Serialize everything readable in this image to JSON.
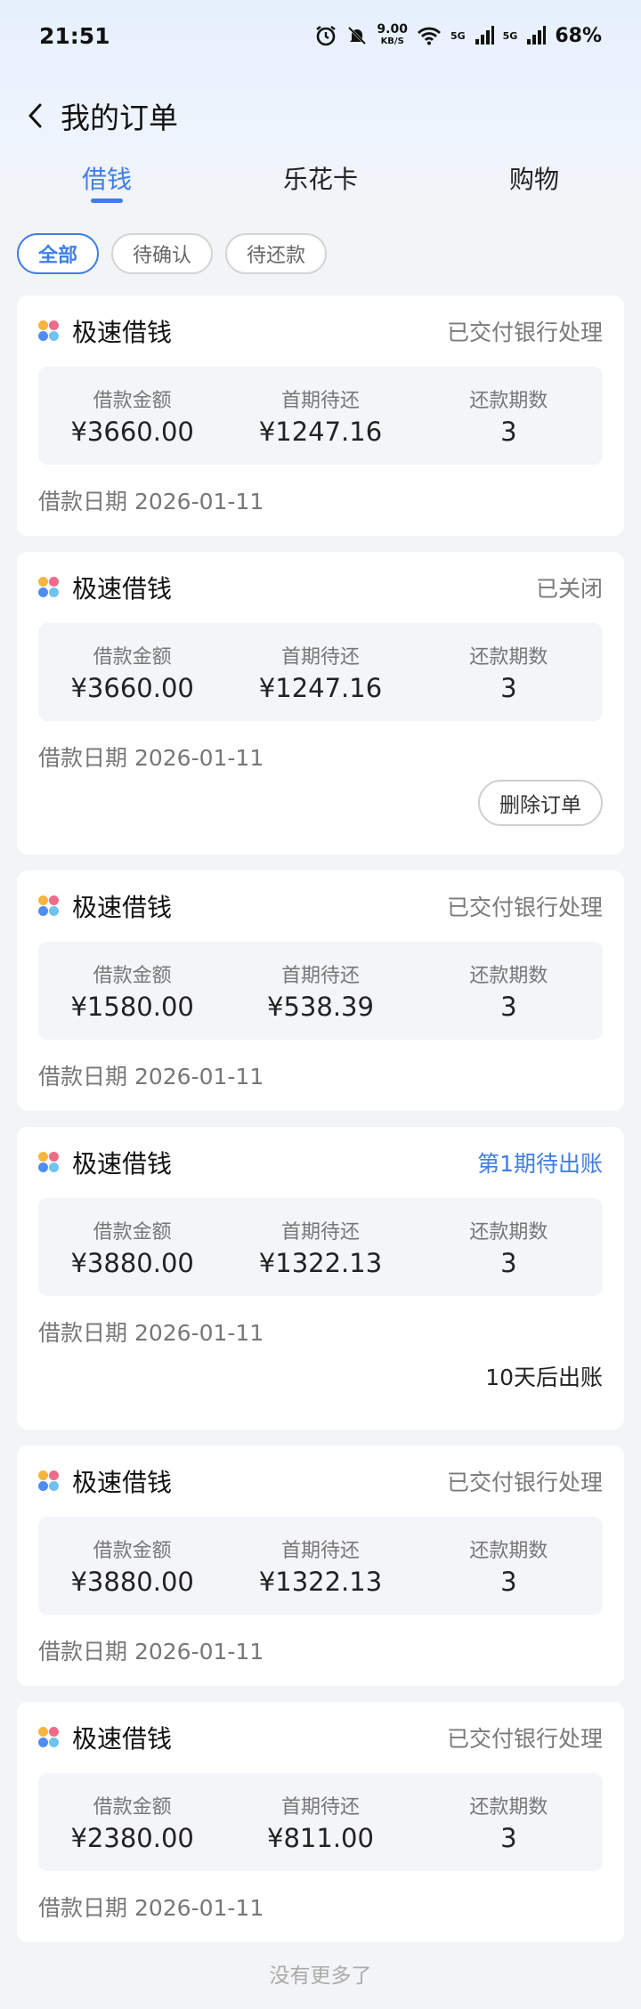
{
  "status_bar": {
    "time": "21:51",
    "net_speed": "9.00",
    "net_unit": "KB/S",
    "sig1": "5G",
    "sig2": "5G",
    "battery": "68%"
  },
  "nav": {
    "title": "我的订单"
  },
  "tabs": [
    {
      "label": "借钱",
      "active": true
    },
    {
      "label": "乐花卡",
      "active": false
    },
    {
      "label": "购物",
      "active": false
    }
  ],
  "filters": [
    {
      "label": "全部",
      "active": true
    },
    {
      "label": "待确认",
      "active": false
    },
    {
      "label": "待还款",
      "active": false
    }
  ],
  "labels": {
    "amount": "借款金额",
    "first_due": "首期待还",
    "periods": "还款期数"
  },
  "orders": [
    {
      "product": "极速借钱",
      "status": "已交付银行处理",
      "amount": "¥3660.00",
      "first_due": "¥1247.16",
      "periods": "3",
      "date": "借款日期 2026-01-11"
    },
    {
      "product": "极速借钱",
      "status": "已关闭",
      "amount": "¥3660.00",
      "first_due": "¥1247.16",
      "periods": "3",
      "date": "借款日期 2026-01-11",
      "action": "删除订单"
    },
    {
      "product": "极速借钱",
      "status": "已交付银行处理",
      "amount": "¥1580.00",
      "first_due": "¥538.39",
      "periods": "3",
      "date": "借款日期 2026-01-11"
    },
    {
      "product": "极速借钱",
      "status": "第1期待出账",
      "amount": "¥3880.00",
      "first_due": "¥1322.13",
      "periods": "3",
      "date": "借款日期 2026-01-11",
      "note": "10天后出账"
    },
    {
      "product": "极速借钱",
      "status": "已交付银行处理",
      "amount": "¥3880.00",
      "first_due": "¥1322.13",
      "periods": "3",
      "date": "借款日期 2026-01-11"
    },
    {
      "product": "极速借钱",
      "status": "已交付银行处理",
      "amount": "¥2380.00",
      "first_due": "¥811.00",
      "periods": "3",
      "date": "借款日期 2026-01-11"
    }
  ],
  "footer": {
    "no_more": "没有更多了"
  },
  "colors": {
    "accent": "#3f7ee8",
    "muted": "#7a7a7a",
    "background": "#f3f4f6"
  }
}
